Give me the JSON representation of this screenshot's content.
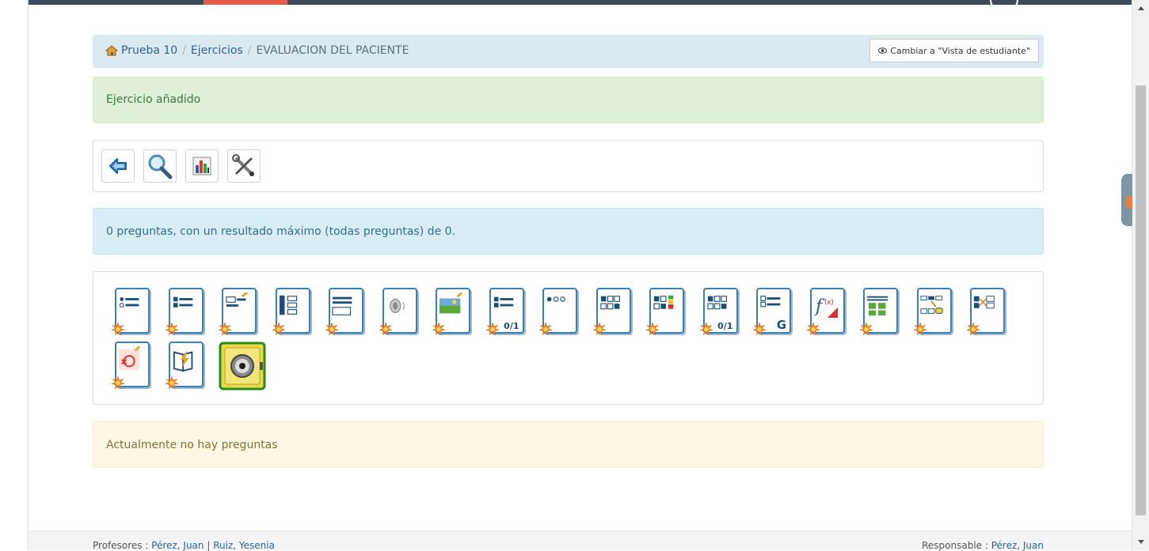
{
  "breadcrumb": {
    "course": "Prueba 10",
    "section": "Ejercicios",
    "current": "EVALUACION DEL PACIENTE",
    "home_icon": "home-icon"
  },
  "view_switch": {
    "label": "Cambiar a \"Vista de estudiante\"",
    "icon": "eye-icon"
  },
  "alerts": {
    "success": "Ejercicio añadido",
    "info": "0 preguntas, con un resultado máximo (todas preguntas) de 0.",
    "warning": "Actualmente no hay preguntas"
  },
  "toolbar": [
    {
      "name": "back-icon"
    },
    {
      "name": "preview-icon"
    },
    {
      "name": "statistics-icon"
    },
    {
      "name": "settings-icon"
    }
  ],
  "question_types": [
    {
      "name": "unique-answer-icon"
    },
    {
      "name": "multiple-answer-icon"
    },
    {
      "name": "fill-blanks-icon"
    },
    {
      "name": "matching-icon"
    },
    {
      "name": "open-question-icon"
    },
    {
      "name": "oral-expression-icon"
    },
    {
      "name": "hotspot-icon"
    },
    {
      "name": "exact-selection-icon",
      "badge": "0/1"
    },
    {
      "name": "unique-answer-no-option-icon"
    },
    {
      "name": "true-false-degree-icon"
    },
    {
      "name": "multiple-answer-combination-icon"
    },
    {
      "name": "combination-true-false-icon",
      "badge": "0/1"
    },
    {
      "name": "global-multiple-answer-icon",
      "badge": "G"
    },
    {
      "name": "calculated-answer-icon"
    },
    {
      "name": "image-zones-icon"
    },
    {
      "name": "drag-drop-icon"
    },
    {
      "name": "matching-draggable-icon"
    },
    {
      "name": "annotation-icon"
    },
    {
      "name": "reading-comprehension-icon"
    },
    {
      "name": "question-bank-icon"
    }
  ],
  "footer": {
    "teachers_label": "Profesores :",
    "teacher_1": "Pérez, Juan",
    "separator": "|",
    "teacher_2": "Ruiz, Yesenia",
    "responsible_label": "Responsable :",
    "responsible": "Pérez, Juan"
  },
  "colors": {
    "nav": "#3a4a5a",
    "active_tab": "#e95b49",
    "icon_blue": "#3b7eb1",
    "star": "#f5821f"
  }
}
